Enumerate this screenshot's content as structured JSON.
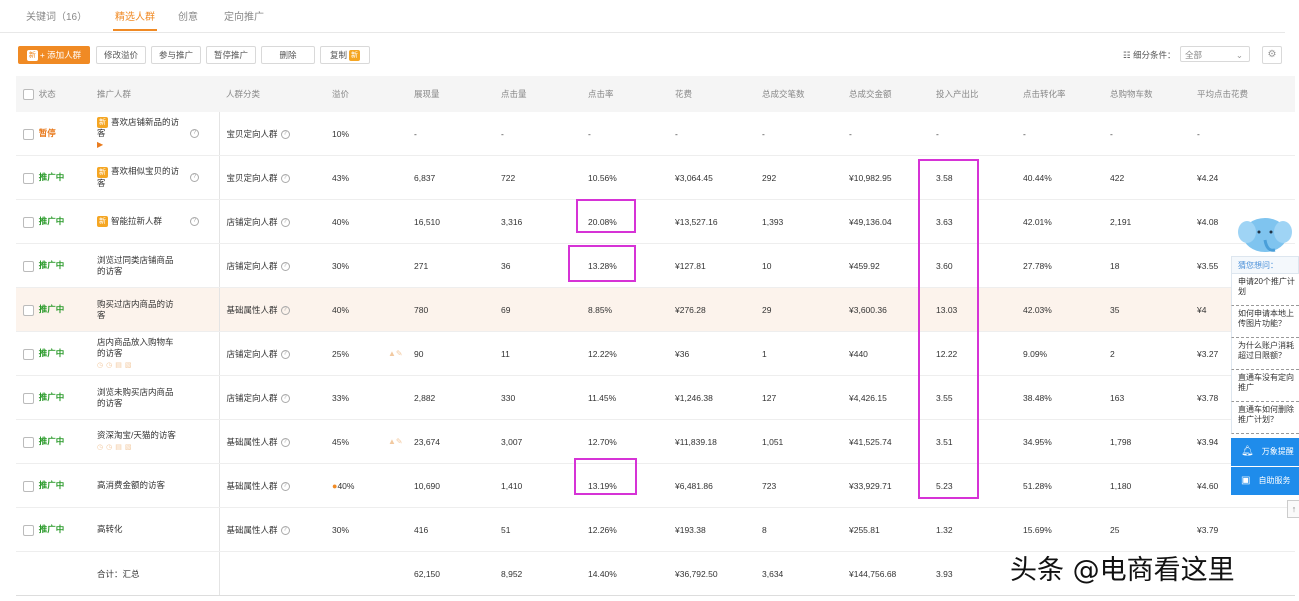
{
  "tabs": [
    {
      "label": "关键词（16）",
      "active": false
    },
    {
      "label": "精选人群",
      "active": true
    },
    {
      "label": "创意",
      "active": false
    },
    {
      "label": "定向推广",
      "active": false
    }
  ],
  "toolbar": {
    "add_label": "+ 添加人群",
    "new_badge": "新",
    "modify_bid": "修改溢价",
    "join_promo": "参与推广",
    "pause_promo": "暂停推广",
    "delete": "删除",
    "copy": "复制",
    "filter_label": "细分条件：",
    "filter_value": "全部"
  },
  "table": {
    "headers": [
      "状态",
      "推广人群",
      "人群分类",
      "溢价",
      "展现量",
      "点击量",
      "点击率",
      "花费",
      "总成交笔数",
      "总成交金额",
      "投入产出比",
      "点击转化率",
      "总购物车数",
      "平均点击花费"
    ],
    "rows": [
      {
        "status": "暂停",
        "name": "喜欢店铺新品的访客",
        "category": "宝贝定向人群",
        "premium": "10%",
        "impressions": "-",
        "clicks": "-",
        "ctr": "-",
        "cost": "-",
        "orders": "-",
        "gmv": "-",
        "roi": "-",
        "cvr": "-",
        "carts": "-",
        "cpc": "-"
      },
      {
        "status": "推广中",
        "name": "喜欢相似宝贝的访客",
        "category": "宝贝定向人群",
        "premium": "43%",
        "impressions": "6,837",
        "clicks": "722",
        "ctr": "10.56%",
        "cost": "¥3,064.45",
        "orders": "292",
        "gmv": "¥10,982.95",
        "roi": "3.58",
        "cvr": "40.44%",
        "carts": "422",
        "cpc": "¥4.24"
      },
      {
        "status": "推广中",
        "name": "智能拉新人群",
        "category": "店铺定向人群",
        "premium": "40%",
        "impressions": "16,510",
        "clicks": "3,316",
        "ctr": "20.08%",
        "cost": "¥13,527.16",
        "orders": "1,393",
        "gmv": "¥49,136.04",
        "roi": "3.63",
        "cvr": "42.01%",
        "carts": "2,191",
        "cpc": "¥4.08"
      },
      {
        "status": "推广中",
        "name": "浏览过同类店铺商品的访客",
        "category": "店铺定向人群",
        "premium": "30%",
        "impressions": "271",
        "clicks": "36",
        "ctr": "13.28%",
        "cost": "¥127.81",
        "orders": "10",
        "gmv": "¥459.92",
        "roi": "3.60",
        "cvr": "27.78%",
        "carts": "18",
        "cpc": "¥3.55"
      },
      {
        "status": "推广中",
        "name": "购买过店内商品的访客",
        "category": "基础属性人群",
        "premium": "40%",
        "impressions": "780",
        "clicks": "69",
        "ctr": "8.85%",
        "cost": "¥276.28",
        "orders": "29",
        "gmv": "¥3,600.36",
        "roi": "13.03",
        "cvr": "42.03%",
        "carts": "35",
        "cpc": "¥4"
      },
      {
        "status": "推广中",
        "name": "店内商品放入购物车的访客",
        "category": "店铺定向人群",
        "premium": "25%",
        "impressions": "90",
        "clicks": "11",
        "ctr": "12.22%",
        "cost": "¥36",
        "orders": "1",
        "gmv": "¥440",
        "roi": "12.22",
        "cvr": "9.09%",
        "carts": "2",
        "cpc": "¥3.27"
      },
      {
        "status": "推广中",
        "name": "浏览未购买店内商品的访客",
        "category": "店铺定向人群",
        "premium": "33%",
        "impressions": "2,882",
        "clicks": "330",
        "ctr": "11.45%",
        "cost": "¥1,246.38",
        "orders": "127",
        "gmv": "¥4,426.15",
        "roi": "3.55",
        "cvr": "38.48%",
        "carts": "163",
        "cpc": "¥3.78"
      },
      {
        "status": "推广中",
        "name": "资深淘宝/天猫的访客",
        "category": "基础属性人群",
        "premium": "45%",
        "impressions": "23,674",
        "clicks": "3,007",
        "ctr": "12.70%",
        "cost": "¥11,839.18",
        "orders": "1,051",
        "gmv": "¥41,525.74",
        "roi": "3.51",
        "cvr": "34.95%",
        "carts": "1,798",
        "cpc": "¥3.94"
      },
      {
        "status": "推广中",
        "name": "高消费金额的访客",
        "category": "基础属性人群",
        "premium": "40%",
        "impressions": "10,690",
        "clicks": "1,410",
        "ctr": "13.19%",
        "cost": "¥6,481.86",
        "orders": "723",
        "gmv": "¥33,929.71",
        "roi": "5.23",
        "cvr": "51.28%",
        "carts": "1,180",
        "cpc": "¥4.60"
      },
      {
        "status": "推广中",
        "name": "高转化",
        "category": "基础属性人群",
        "premium": "30%",
        "impressions": "416",
        "clicks": "51",
        "ctr": "12.26%",
        "cost": "¥193.38",
        "orders": "8",
        "gmv": "¥255.81",
        "roi": "1.32",
        "cvr": "15.69%",
        "carts": "25",
        "cpc": "¥3.79"
      }
    ],
    "total": {
      "label": "合计：汇总",
      "impressions": "62,150",
      "clicks": "8,952",
      "ctr": "14.40%",
      "cost": "¥36,792.50",
      "orders": "3,634",
      "gmv": "¥144,756.68",
      "roi": "3.93"
    }
  },
  "side_panel": {
    "title": "猜您想问：",
    "questions": [
      "申请20个推广计划",
      "如何申请本地上传图片功能？",
      "为什么账户消耗超过日限额？",
      "直通车没有定向推广",
      "直通车如何删除推广计划？"
    ],
    "remind_label": "万象提醒",
    "service_label": "自助服务"
  },
  "watermark": "头条 @电商看这里",
  "accent_color": "#f08a24",
  "highlight_color": "#d633d6"
}
